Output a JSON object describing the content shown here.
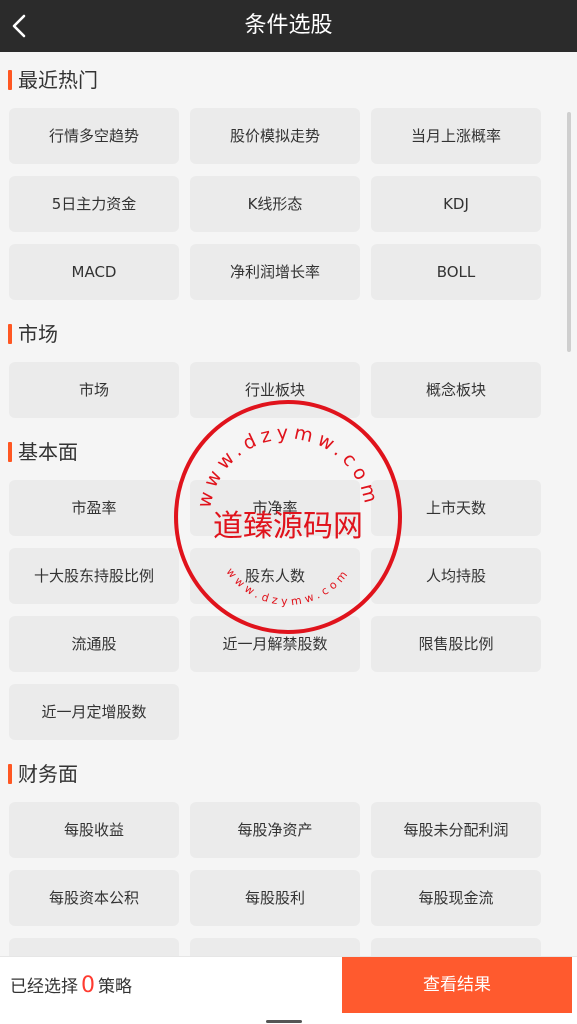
{
  "header": {
    "title": "条件选股",
    "back_icon": "chevron-left-icon"
  },
  "colors": {
    "header_bg": "#2b2b2b",
    "accent": "#ff5a2e",
    "count_red": "#ff3b30",
    "chip_bg": "#ebebeb",
    "watermark_red": "#e0131c"
  },
  "sections": [
    {
      "title": "最近热门",
      "items": [
        "行情多空趋势",
        "股价模拟走势",
        "当月上涨概率",
        "5日主力资金",
        "K线形态",
        "KDJ",
        "MACD",
        "净利润增长率",
        "BOLL"
      ]
    },
    {
      "title": "市场",
      "items": [
        "市场",
        "行业板块",
        "概念板块"
      ]
    },
    {
      "title": "基本面",
      "items": [
        "市盈率",
        "市净率",
        "上市天数",
        "十大股东持股比例",
        "股东人数",
        "人均持股",
        "流通股",
        "近一月解禁股数",
        "限售股比例",
        "近一月定增股数"
      ]
    },
    {
      "title": "财务面",
      "items": [
        "每股收益",
        "每股净资产",
        "每股未分配利润",
        "每股资本公积",
        "每股股利",
        "每股现金流"
      ]
    }
  ],
  "footer": {
    "selected_prefix": "已经选择",
    "selected_count": "0",
    "selected_suffix": "策略",
    "result_button": "查看结果"
  },
  "watermark": {
    "text": "道臻源码网",
    "url_top": "www.dzymw.com",
    "url_bottom": "www.dzymw.com"
  }
}
